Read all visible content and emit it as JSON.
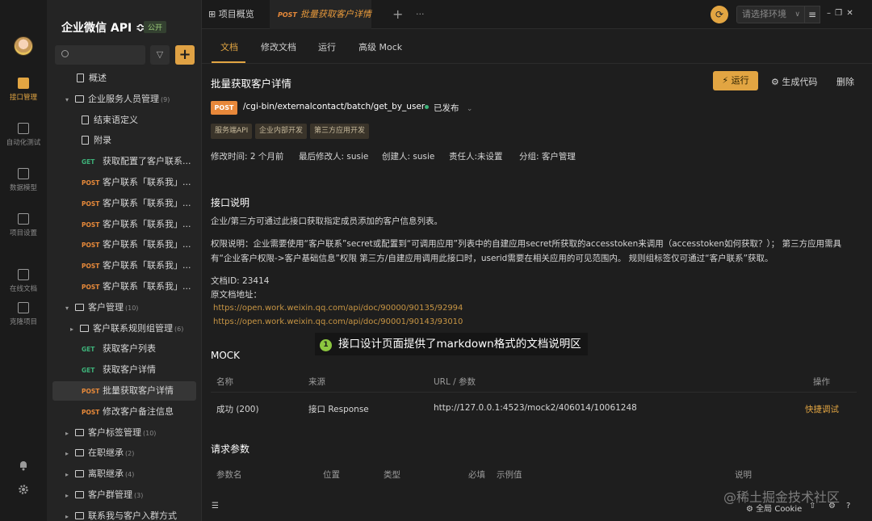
{
  "rail": {
    "items": [
      {
        "label": "接口管理"
      },
      {
        "label": "自动化测试"
      },
      {
        "label": "数据模型"
      },
      {
        "label": "项目设置"
      },
      {
        "label": "在线文档"
      },
      {
        "label": "克隆项目"
      }
    ]
  },
  "sidebar": {
    "project_title": "企业微信 API ≎",
    "public_badge": "公开",
    "add_label": "+",
    "tree": [
      {
        "kind": "doc",
        "label": "概述"
      },
      {
        "kind": "folder",
        "label": "企业服务人员管理",
        "count": "(9)"
      },
      {
        "kind": "doc",
        "label": "结束语定义"
      },
      {
        "kind": "doc",
        "label": "附录"
      },
      {
        "kind": "api",
        "method": "GET",
        "label": "获取配置了客户联系..."
      },
      {
        "kind": "api",
        "method": "POST",
        "label": "客户联系「联系我」..."
      },
      {
        "kind": "api",
        "method": "POST",
        "label": "客户联系「联系我」..."
      },
      {
        "kind": "api",
        "method": "POST",
        "label": "客户联系「联系我」..."
      },
      {
        "kind": "api",
        "method": "POST",
        "label": "客户联系「联系我」..."
      },
      {
        "kind": "api",
        "method": "POST",
        "label": "客户联系「联系我」..."
      },
      {
        "kind": "api",
        "method": "POST",
        "label": "客户联系「联系我」..."
      },
      {
        "kind": "folder",
        "label": "客户管理",
        "count": "(10)"
      },
      {
        "kind": "folder",
        "label": "客户联系规则组管理",
        "count": "(6)"
      },
      {
        "kind": "api",
        "method": "GET",
        "label": "获取客户列表"
      },
      {
        "kind": "api",
        "method": "GET",
        "label": "获取客户详情"
      },
      {
        "kind": "api",
        "method": "POST",
        "label": "批量获取客户详情"
      },
      {
        "kind": "api",
        "method": "POST",
        "label": "修改客户备注信息"
      },
      {
        "kind": "folder",
        "label": "客户标签管理",
        "count": "(10)"
      },
      {
        "kind": "folder",
        "label": "在职继承",
        "count": "(2)"
      },
      {
        "kind": "folder",
        "label": "离职继承",
        "count": "(4)"
      },
      {
        "kind": "folder",
        "label": "客户群管理",
        "count": "(3)"
      },
      {
        "kind": "folder",
        "label": "联系我与客户入群方式",
        "count": ""
      }
    ]
  },
  "tabbar": {
    "overview_tab": "项目概览",
    "active_tab_method": "POST",
    "active_tab_label": "批量获取客户详情",
    "new_tab": "+",
    "more": "···",
    "env_placeholder": "请选择环境",
    "env_chevron": "∨",
    "menu": "≡",
    "win_controls": "–  ❐  ✕"
  },
  "main": {
    "subtabs": [
      "文档",
      "修改文档",
      "运行",
      "高级 Mock"
    ],
    "title": "批量获取客户详情",
    "run_label": "运行",
    "gen_code_label": "生成代码",
    "delete_label": "删除",
    "method": "POST",
    "path": "/cgi-bin/externalcontact/batch/get_by_user",
    "status": "已发布",
    "tags": [
      "服务端API",
      "企业内部开发",
      "第三方应用开发"
    ],
    "meta": {
      "modified": "修改时间: 2 个月前",
      "last_editor": "最后修改人: susie",
      "creator": "创建人: susie",
      "owner": "责任人:未设置",
      "group": "分组: 客户管理"
    },
    "desc_heading": "接口说明",
    "desc_line1": "企业/第三方可通过此接口获取指定成员添加的客户信息列表。",
    "desc_line2": "权限说明：企业需要使用“客户联系”secret或配置到“可调用应用”列表中的自建应用secret所获取的accesstoken来调用（accesstoken如何获取？）；  第三方应用需具有“企业客户权限->客户基础信息”权限 第三方/自建应用调用此接口时，userid需要在相关应用的可见范围内。 规则组标签仅可通过“客户联系”获取。",
    "doc_id": "文档ID: 23414",
    "doc_url_label": "原文档地址：",
    "links": [
      "https://open.work.weixin.qq.com/api/doc/90000/90135/92994",
      "https://open.work.weixin.qq.com/api/doc/90001/90143/93010"
    ],
    "overlay_num": "1",
    "overlay_text": "接口设计页面提供了markdown格式的文档说明区",
    "mock_heading": "MOCK",
    "mock_headers": {
      "name": "名称",
      "source": "来源",
      "url": "URL / 参数",
      "op": "操作"
    },
    "mock_row": {
      "name": "成功 (200)",
      "source": "接口 Response",
      "url": "http://127.0.0.1:4523/mock2/406014/10061248",
      "op": "快捷调试"
    },
    "params_heading": "请求参数",
    "params_headers": {
      "name": "参数名",
      "position": "位置",
      "type": "类型",
      "required": "必填",
      "example": "示例值",
      "desc": "说明"
    }
  },
  "footer": {
    "cookie": "全局 Cookie",
    "watermark": "@稀土掘金技术社区"
  },
  "colors": {
    "accent": "#e2a542",
    "post": "#e88a3a",
    "get": "#3eb37a"
  }
}
